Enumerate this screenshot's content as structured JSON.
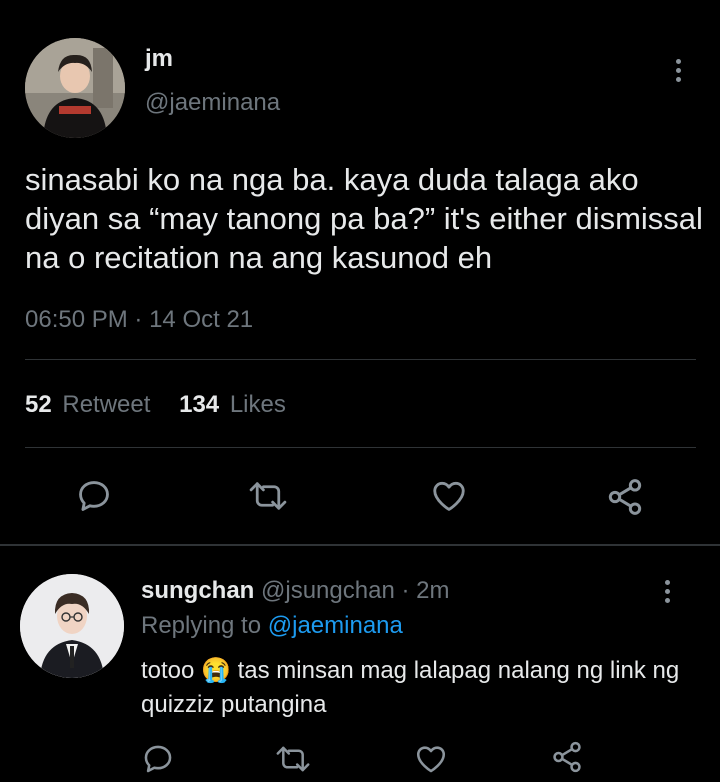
{
  "tweet": {
    "name": "jm",
    "handle": "@jaeminana",
    "text": "sinasabi ko na nga ba. kaya duda talaga ako diyan sa “may tanong pa ba?” it's either dismissal na o recitation na ang kasunod eh",
    "time": "06:50 PM",
    "date_sep": "·",
    "date": "14 Oct 21",
    "retweets_count": "52",
    "retweets_label": "Retweet",
    "likes_count": "134",
    "likes_label": "Likes"
  },
  "reply": {
    "name": "sungchan",
    "handle": "@jsungchan",
    "sep": "·",
    "age": "2m",
    "replying_prefix": "Replying to",
    "replying_to": "@jaeminana",
    "text_before_emoji": "totoo",
    "emoji": "😭",
    "text_after_emoji": "tas minsan mag lalapag nalang ng link ng quizziz putangina"
  },
  "icons": [
    "avatar",
    "more-vertical-icon",
    "reply-icon",
    "retweet-icon",
    "like-icon",
    "share-icon"
  ],
  "colors": {
    "background": "#000000",
    "text": "#e7e9ea",
    "muted": "#6e767d",
    "link": "#1d9bf0",
    "divider": "#2f3336"
  }
}
